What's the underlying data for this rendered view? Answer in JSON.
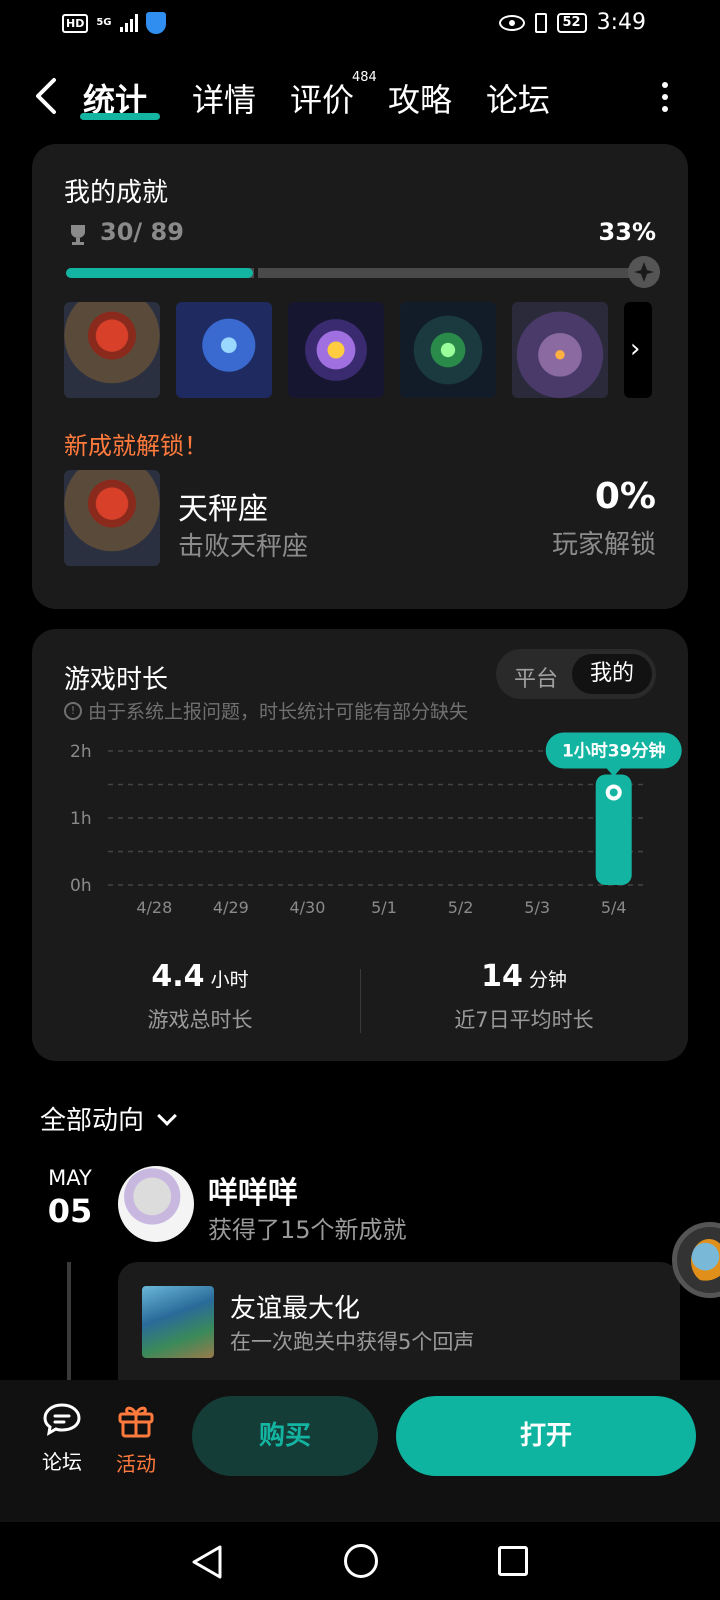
{
  "status_bar": {
    "network": "HD",
    "signal": "5G",
    "battery": "52",
    "time": "3:49"
  },
  "nav": {
    "tabs": [
      {
        "label": "统计",
        "active": true
      },
      {
        "label": "详情"
      },
      {
        "label": "评价",
        "badge": "484"
      },
      {
        "label": "攻略"
      },
      {
        "label": "论坛"
      }
    ]
  },
  "achievements": {
    "title": "我的成就",
    "count": "30/ 89",
    "percent": "33%",
    "progress": 0.33,
    "thumbnails": [
      "achievement-1",
      "achievement-2",
      "achievement-3",
      "achievement-4",
      "achievement-5"
    ],
    "new_unlock_label": "新成就解锁！",
    "new_unlock": {
      "name": "天秤座",
      "desc": "击败天秤座",
      "rate": "0%",
      "rate_label": "玩家解锁"
    }
  },
  "playtime": {
    "title": "游戏时长",
    "note": "由于系统上报问题，时长统计可能有部分缺失",
    "toggle": [
      "平台",
      "我的"
    ],
    "toggle_selected": "我的",
    "total_value": "4.4",
    "total_unit": "小时",
    "total_label": "游戏总时长",
    "avg_value": "14",
    "avg_unit": "分钟",
    "avg_label": "近7日平均时长"
  },
  "chart_data": {
    "type": "bar",
    "categories": [
      "4/28",
      "4/29",
      "4/30",
      "5/1",
      "5/2",
      "5/3",
      "5/4"
    ],
    "values": [
      0,
      0,
      0,
      0,
      0,
      0,
      1.65
    ],
    "yticks": [
      "0h",
      "1h",
      "2h"
    ],
    "ylim": [
      0,
      2
    ],
    "ylabel": "",
    "xlabel": "",
    "annotation": "1小时39分钟",
    "color": "#14b4a2",
    "grid": true
  },
  "feed": {
    "header": "全部动向",
    "entries": [
      {
        "month": "MAY",
        "day": "05",
        "user": "咩咩咩",
        "desc": "获得了15个新成就",
        "card_title": "友谊最大化",
        "card_desc": "在一次跑关中获得5个回声"
      }
    ]
  },
  "bottom_bar": {
    "forum_label": "论坛",
    "activity_label": "活动",
    "buy_label": "购买",
    "open_label": "打开"
  },
  "colors": {
    "accent": "#14b4a2",
    "orange": "#ff7a3d",
    "card": "#1b1b1b"
  }
}
